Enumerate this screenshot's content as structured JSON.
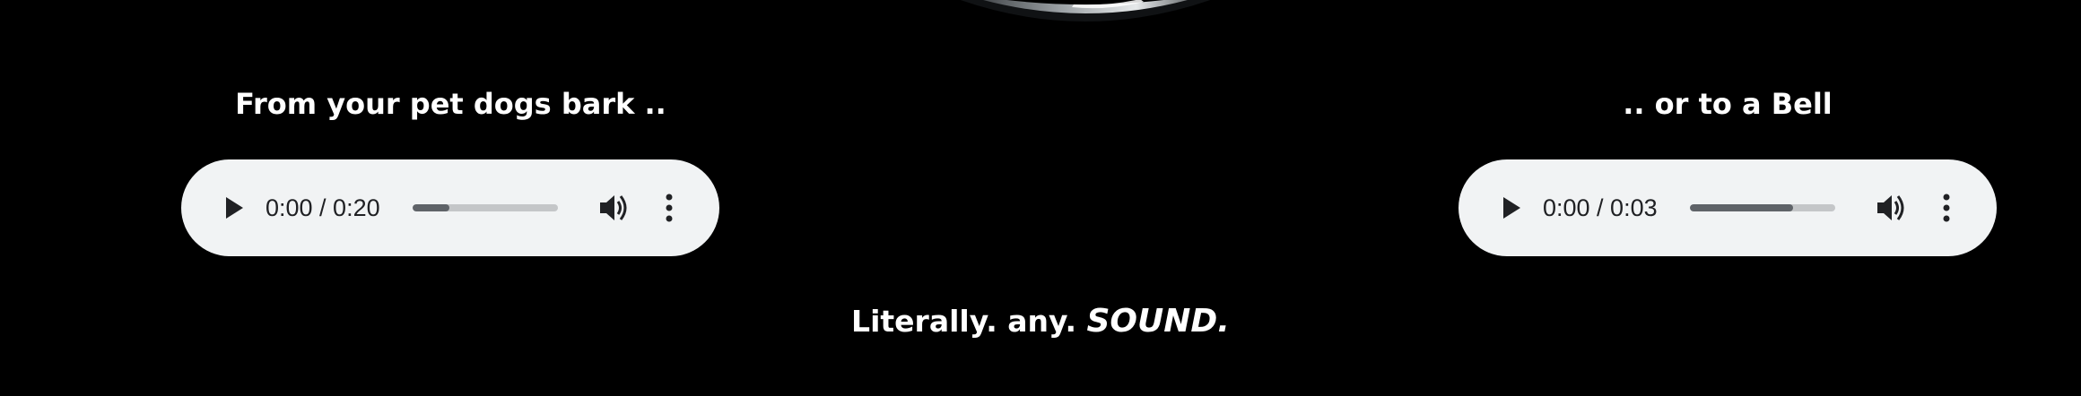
{
  "captions": {
    "left": "From your pet dogs bark ..",
    "right": ".. or to a Bell"
  },
  "players": {
    "left": {
      "time": "0:00 / 0:20",
      "progress": 0.25,
      "icons": [
        "play-icon",
        "volume-icon",
        "more-vert-icon"
      ]
    },
    "right": {
      "time": "0:00 / 0:03",
      "progress": 0.71,
      "icons": [
        "play-icon",
        "volume-icon",
        "more-vert-icon"
      ]
    }
  },
  "tagline": {
    "main": "Literally. any.",
    "emphasis": "SOUND."
  },
  "colors": {
    "background": "#000000",
    "player_bg": "#f1f3f4",
    "text": "#ffffff"
  }
}
